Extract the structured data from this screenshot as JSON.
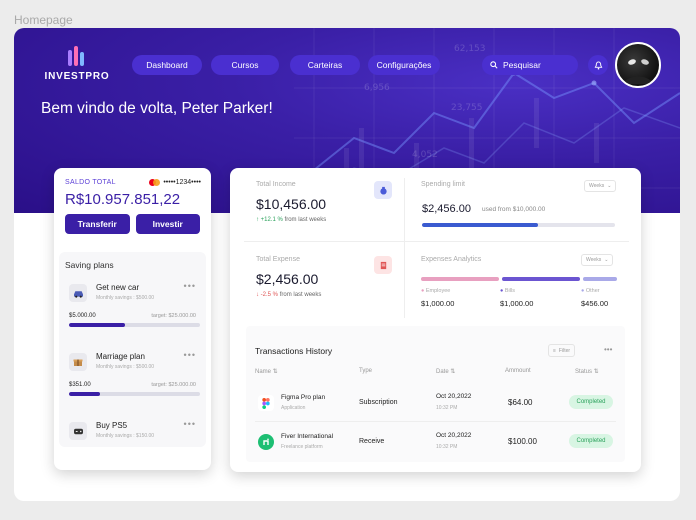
{
  "page_label": "Homepage",
  "brand": {
    "name": "INVESTPRO"
  },
  "nav": {
    "items": [
      {
        "label": "Dashboard"
      },
      {
        "label": "Cursos"
      },
      {
        "label": "Carteiras"
      },
      {
        "label": "Configurações"
      }
    ],
    "search_label": "Pesquisar"
  },
  "hero": {
    "welcome": "Bem vindo de volta, Peter Parker!",
    "background_numbers": [
      "6,956",
      "23,755",
      "4,052",
      "62,153"
    ]
  },
  "wallet": {
    "label": "SALDO TOTAL",
    "card_number": "•••••1234••••",
    "balance": "R$10.957.851,22",
    "transfer_label": "Transferir",
    "invest_label": "Investir"
  },
  "savings": {
    "title": "Saving plans",
    "more": "•••",
    "plans": [
      {
        "name": "Get new car",
        "sub": "Monthly savings : $500.00",
        "amount": "$5.000.00",
        "target": "target: $25.000.00",
        "progress": 0.43,
        "icon": "car-icon"
      },
      {
        "name": "Marriage plan",
        "sub": "Monthly savings : $500.00",
        "amount": "$351.00",
        "target": "target: $25.000.00",
        "progress": 0.24,
        "icon": "gift-icon"
      },
      {
        "name": "Buy PS5",
        "sub": "Monthly savings : $150.00",
        "icon": "gamepad-icon"
      }
    ]
  },
  "stats": {
    "income": {
      "label": "Total Income",
      "value": "$10,456.00",
      "change": "+12.1 %",
      "suffix": "from last weeks",
      "icon": "money-bag-icon"
    },
    "expense": {
      "label": "Total Expense",
      "value": "$2,456.00",
      "change": "-2.5 %",
      "suffix": "from last weeks",
      "icon": "receipt-icon"
    },
    "spending": {
      "label": "Spending limit",
      "value": "$2,456.00",
      "used": "used from $10,000.00",
      "period": "Weeks",
      "progress": 0.6
    },
    "analytics": {
      "label": "Expenses Analytics",
      "period": "Weeks",
      "segments": [
        {
          "name": "Employee",
          "value": "$1,000.00",
          "color": "#e8a0c0"
        },
        {
          "name": "Bills",
          "value": "$1,000.00",
          "color": "#6b55d1"
        },
        {
          "name": "Other",
          "value": "$456.00",
          "color": "#a9a9e8"
        }
      ]
    }
  },
  "transactions": {
    "title": "Transactions History",
    "filter_label": "Filter",
    "more": "•••",
    "columns": [
      "Name",
      "Type",
      "Date",
      "Ammount",
      "Status"
    ],
    "rows": [
      {
        "name": "Figma Pro plan",
        "sub": "Application",
        "type": "Subscription",
        "date": "Oct 20,2022",
        "time": "10:32 PM",
        "amount": "$64.00",
        "status": "Completed",
        "icon": "figma-icon"
      },
      {
        "name": "Fiver International",
        "sub": "Freelance platform",
        "type": "Receive",
        "date": "Oct 20,2022",
        "time": "10:32 PM",
        "amount": "$100.00",
        "status": "Completed",
        "icon": "fiverr-icon"
      }
    ]
  },
  "colors": {
    "brand": "#3a1fa6",
    "nav_pill": "#4a2fd0",
    "positive": "#2aa15b",
    "negative": "#e05555"
  }
}
